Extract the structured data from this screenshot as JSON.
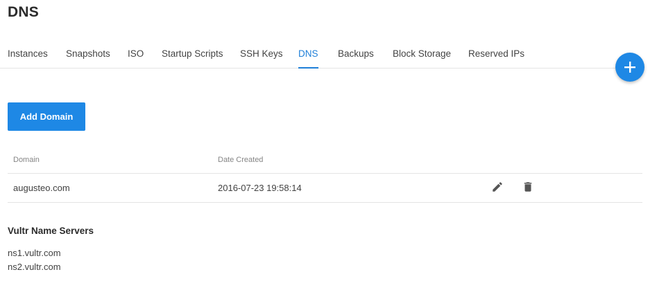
{
  "page": {
    "title": "DNS"
  },
  "tabs": [
    {
      "label": "Instances",
      "active": false
    },
    {
      "label": "Snapshots",
      "active": false
    },
    {
      "label": "ISO",
      "active": false
    },
    {
      "label": "Startup Scripts",
      "active": false
    },
    {
      "label": "SSH Keys",
      "active": false
    },
    {
      "label": "DNS",
      "active": true
    },
    {
      "label": "Backups",
      "active": false
    },
    {
      "label": "Block Storage",
      "active": false
    },
    {
      "label": "Reserved IPs",
      "active": false
    }
  ],
  "fab": {
    "icon": "plus-icon"
  },
  "actions": {
    "add_domain_label": "Add Domain"
  },
  "table": {
    "columns": {
      "domain": "Domain",
      "date_created": "Date Created"
    },
    "rows": [
      {
        "domain": "augusteo.com",
        "date_created": "2016-07-23 19:58:14",
        "actions": [
          "pencil-icon",
          "trash-icon"
        ]
      }
    ]
  },
  "name_servers": {
    "title": "Vultr Name Servers",
    "items": [
      "ns1.vultr.com",
      "ns2.vultr.com"
    ]
  },
  "colors": {
    "accent": "#1e88e5",
    "active_tab": "#1e7fd8",
    "text": "#414141",
    "muted": "#858585",
    "border": "#e4e4e4"
  }
}
